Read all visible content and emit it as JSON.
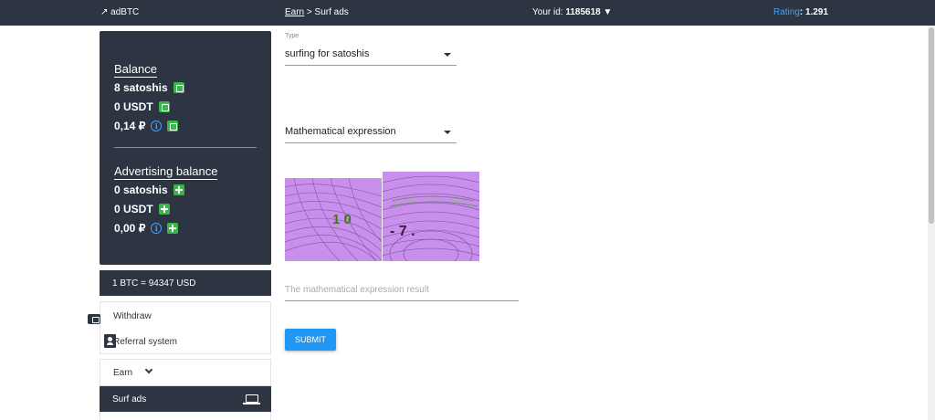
{
  "header": {
    "logo": "↗ adBTC",
    "breadcrumb_earn": "Earn",
    "breadcrumb_sep": " > ",
    "breadcrumb_current": "Surf ads",
    "user_id_label": "Your id: ",
    "user_id": "1185618",
    "user_id_caret": "▼",
    "rating_label": "Rating",
    "rating_value": ": 1.291"
  },
  "balance": {
    "title": "Balance",
    "satoshis": "8 satoshis",
    "usdt": "0 USDT",
    "rub": "0,14 ₽"
  },
  "advertising": {
    "title": "Advertising balance",
    "satoshis": "0 satoshis",
    "usdt": "0 USDT",
    "rub": "0,00 ₽"
  },
  "rate": "1 BTC = 94347 USD",
  "menu": {
    "withdraw": "Withdraw",
    "referral": "Referral system",
    "earn": "Earn",
    "surf_ads": "Surf ads"
  },
  "form": {
    "type_label": "Type",
    "type_value": "surfing for  satoshis",
    "expression_select": "Mathematical expression",
    "result_placeholder": "The mathematical expression result",
    "submit_label": "SUBMIT"
  },
  "captcha": {
    "left_glyphs": "1 0",
    "right_glyphs": "- 7 ."
  },
  "colors": {
    "header_bg": "#2d3442",
    "accent": "#2196f3",
    "wallet_green": "#3cb54a",
    "rating_blue": "#3fa3ff",
    "captcha_bg": "#c890ec"
  }
}
